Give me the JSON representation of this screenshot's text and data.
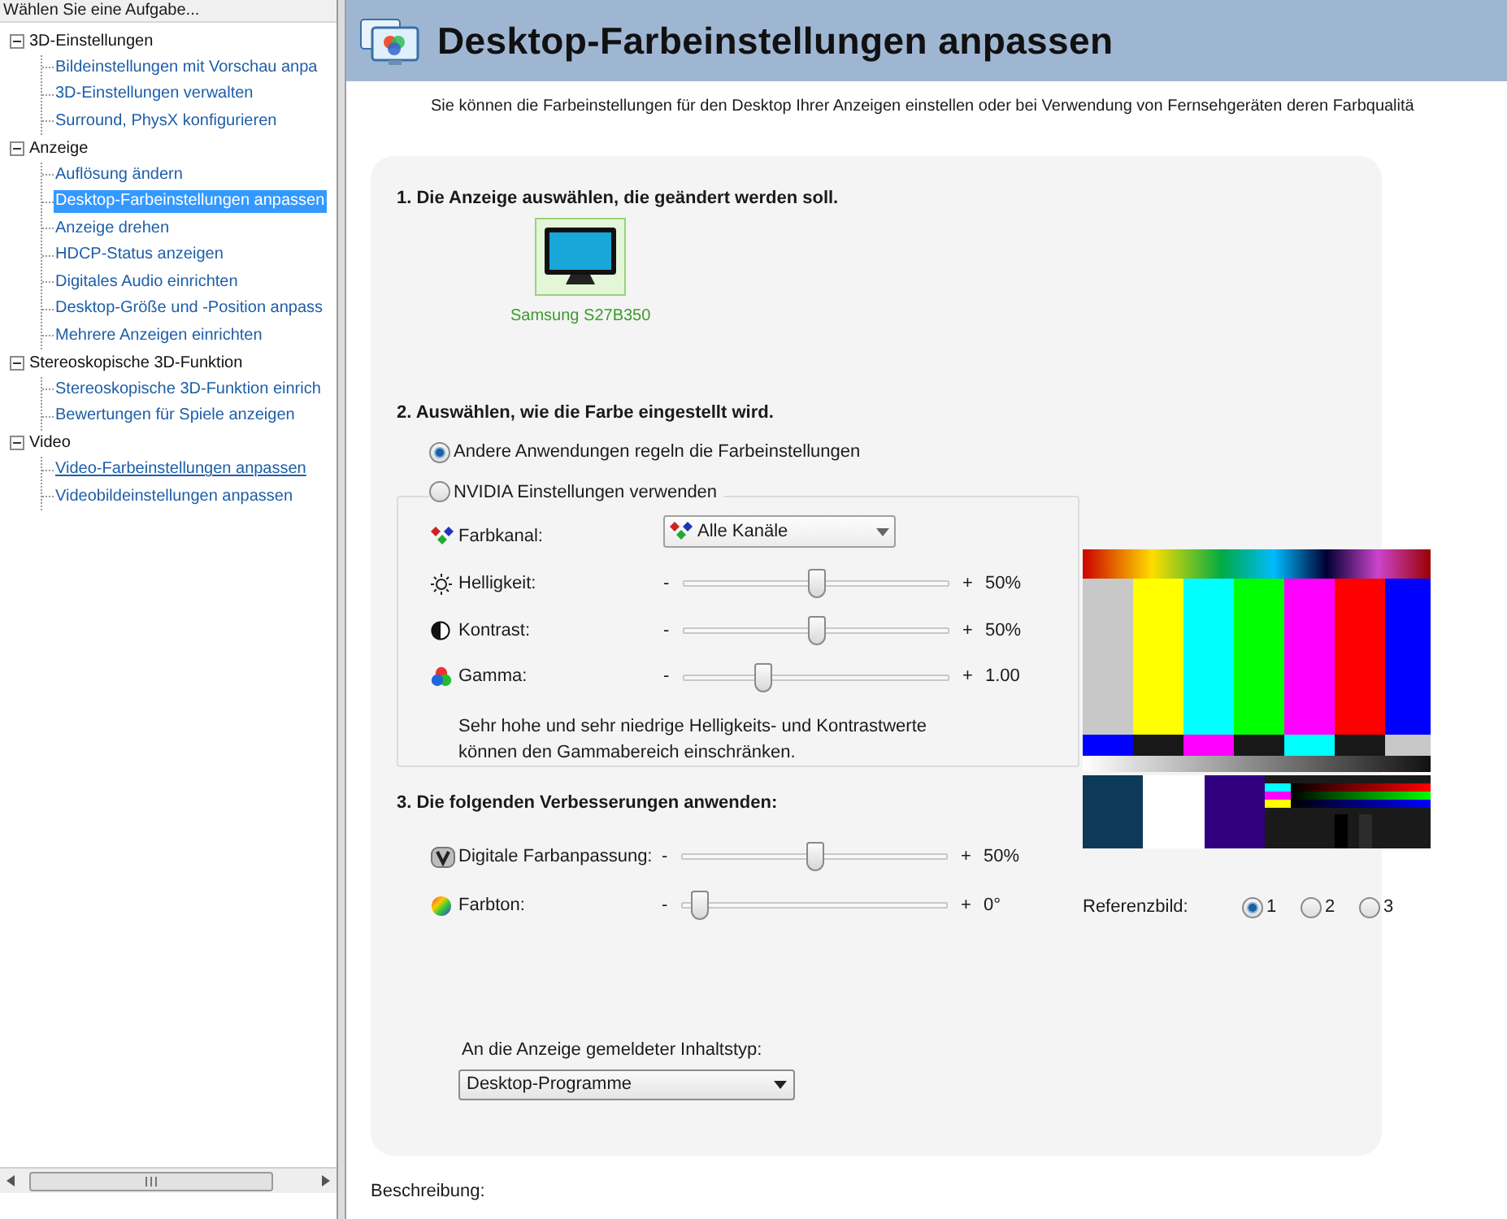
{
  "sidebar": {
    "header": "Wählen Sie eine Aufgabe...",
    "tree": [
      {
        "label": "3D-Einstellungen",
        "expanded": true,
        "children": [
          {
            "label": "Bildeinstellungen mit Vorschau anpa",
            "selected": false,
            "hovered": false
          },
          {
            "label": "3D-Einstellungen verwalten",
            "selected": false,
            "hovered": false
          },
          {
            "label": "Surround, PhysX konfigurieren",
            "selected": false,
            "hovered": false
          }
        ]
      },
      {
        "label": "Anzeige",
        "expanded": true,
        "children": [
          {
            "label": "Auflösung ändern",
            "selected": false,
            "hovered": false
          },
          {
            "label": "Desktop-Farbeinstellungen anpassen",
            "selected": true,
            "hovered": false
          },
          {
            "label": "Anzeige drehen",
            "selected": false,
            "hovered": false
          },
          {
            "label": "HDCP-Status anzeigen",
            "selected": false,
            "hovered": false
          },
          {
            "label": "Digitales Audio einrichten",
            "selected": false,
            "hovered": false
          },
          {
            "label": "Desktop-Größe und -Position anpass",
            "selected": false,
            "hovered": false
          },
          {
            "label": "Mehrere Anzeigen einrichten",
            "selected": false,
            "hovered": false
          }
        ]
      },
      {
        "label": "Stereoskopische 3D-Funktion",
        "expanded": true,
        "children": [
          {
            "label": "Stereoskopische 3D-Funktion einrich",
            "selected": false,
            "hovered": false
          },
          {
            "label": "Bewertungen für Spiele anzeigen",
            "selected": false,
            "hovered": false
          }
        ]
      },
      {
        "label": "Video",
        "expanded": true,
        "children": [
          {
            "label": "Video-Farbeinstellungen anpassen",
            "selected": false,
            "hovered": true
          },
          {
            "label": "Videobildeinstellungen anpassen",
            "selected": false,
            "hovered": false
          }
        ]
      }
    ]
  },
  "page": {
    "title": "Desktop-Farbeinstellungen anpassen",
    "description": "Sie können die Farbeinstellungen für den Desktop Ihrer Anzeigen einstellen oder bei Verwendung von Fernsehgeräten deren Farbqualitä"
  },
  "section_1": {
    "heading": "1. Die Anzeige auswählen, die geändert werden soll.",
    "displays": [
      {
        "name": "Samsung S27B350",
        "selected": true
      }
    ]
  },
  "section_2": {
    "heading": "2. Auswählen, wie die Farbe eingestellt wird.",
    "options": [
      {
        "label": "Andere Anwendungen regeln die Farbeinstellungen",
        "selected": true
      },
      {
        "label": "NVIDIA Einstellungen verwenden",
        "selected": false
      }
    ],
    "controls": [
      {
        "kind": "dropdown",
        "label": "Farbkanal:",
        "value": "Alle Kanäle"
      },
      {
        "kind": "slider",
        "label": "Helligkeit:",
        "minus": "-",
        "plus": "+",
        "level": 0.5,
        "reading": "50%"
      },
      {
        "kind": "slider",
        "label": "Kontrast:",
        "minus": "-",
        "plus": "+",
        "level": 0.5,
        "reading": "50%"
      },
      {
        "kind": "slider",
        "label": "Gamma:",
        "minus": "-",
        "plus": "+",
        "level": 0.29,
        "reading": "1.00"
      }
    ],
    "note": "Sehr hohe und sehr niedrige Helligkeits- und Kontrastwerte können den Gammabereich einschränken."
  },
  "section_3": {
    "heading": "3. Die folgenden Verbesserungen anwenden:",
    "controls": [
      {
        "kind": "slider",
        "label": "Digitale Farbanpassung:",
        "minus": "-",
        "plus": "+",
        "level": 0.5,
        "reading": "50%"
      },
      {
        "kind": "slider",
        "label": "Farbton:",
        "minus": "-",
        "plus": "+",
        "level": 0.04,
        "reading": "0°"
      }
    ],
    "content_type": {
      "label": "An die Anzeige gemeldeter Inhaltstyp:",
      "value": "Desktop-Programme"
    }
  },
  "reference": {
    "label": "Referenzbild:",
    "options": [
      {
        "label": "1",
        "selected": true
      },
      {
        "label": "2",
        "selected": false
      },
      {
        "label": "3",
        "selected": false
      }
    ]
  },
  "description_label": "Beschreibung:"
}
